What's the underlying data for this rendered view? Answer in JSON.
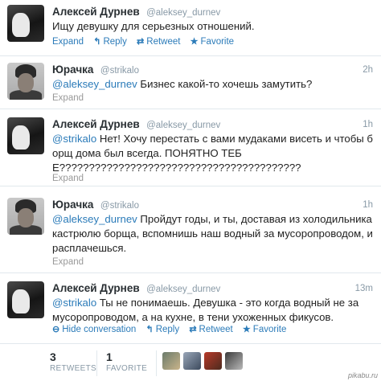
{
  "tweets": [
    {
      "name": "Алексей Дурнев",
      "handle": "@aleksey_durnev",
      "time": "",
      "mention": "",
      "text": "Ищу девушку для серьезных отношений.",
      "actions": {
        "expand": "Expand",
        "reply": "Reply",
        "retweet": "Retweet",
        "favorite": "Favorite"
      }
    },
    {
      "name": "Юрачка",
      "handle": "@strikalo",
      "time": "2h",
      "mention": "@aleksey_durnev",
      "text": " Бизнес какой-то хочешь замутить?",
      "expand": "Expand"
    },
    {
      "name": "Алексей Дурнев",
      "handle": "@aleksey_durnev",
      "time": "1h",
      "mention": "@strikalo",
      "text": " Нет! Хочу перестать с вами мудаками висеть и чтобы борщ дома был всегда. ПОНЯТНО ТЕБЕ?????????????????????????????????????????",
      "expand": "Expand"
    },
    {
      "name": "Юрачка",
      "handle": "@strikalo",
      "time": "1h",
      "mention": "@aleksey_durnev",
      "text": " Пройдут годы, и ты, доставая из холодильника кастрюлю борща, вспомнишь наш водный за мусоропроводом, и расплачешься.",
      "expand": "Expand"
    },
    {
      "name": "Алексей Дурнев",
      "handle": "@aleksey_durnev",
      "time": "13m",
      "mention": "@strikalo",
      "text": " Ты не понимаешь. Девушка - это когда водный не за мусоропроводом, а на кухне, в тени ухоженных фикусов.",
      "actions": {
        "hide": "Hide conversation",
        "reply": "Reply",
        "retweet": "Retweet",
        "favorite": "Favorite"
      }
    }
  ],
  "stats": {
    "retweets_count": "3",
    "retweets_label": "RETWEETS",
    "favorites_count": "1",
    "favorites_label": "FAVORITE"
  },
  "watermark": "pikabu.ru",
  "icons": {
    "reply": "reply-arrow",
    "retweet": "retweet-arrows",
    "favorite": "star",
    "hide": "circle-minus"
  },
  "colors": {
    "link": "#2b7bb9",
    "meta": "#8899a6",
    "name": "#292f33",
    "divider": "#e1e8ed"
  }
}
